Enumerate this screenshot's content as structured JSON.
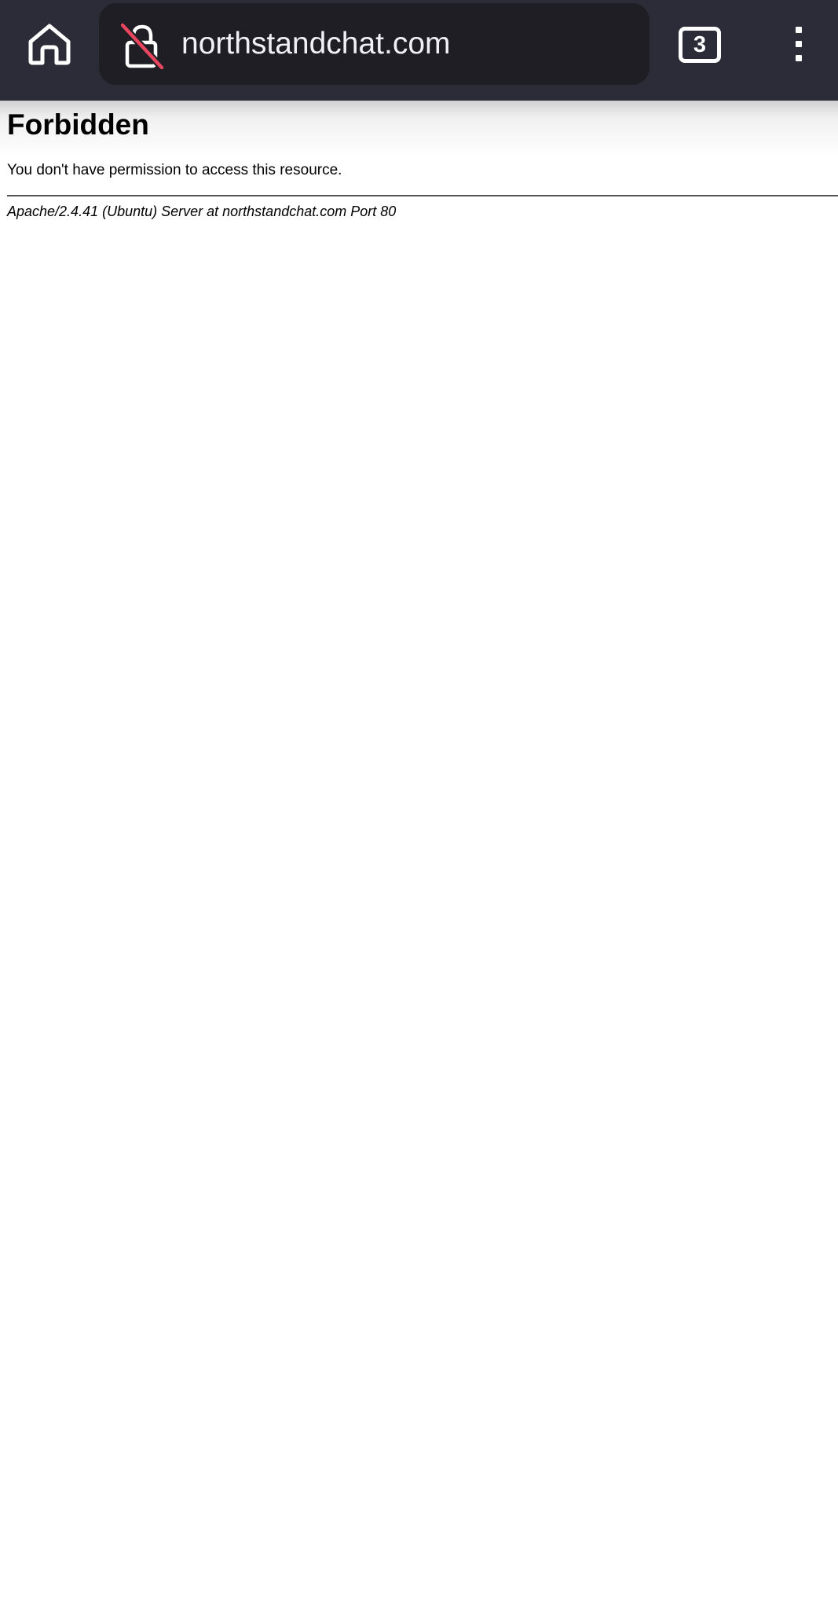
{
  "browser": {
    "url": "northstandchat.com",
    "tab_count": "3",
    "icons": {
      "home": "home-icon",
      "lock": "not-secure-lock-icon",
      "tabs": "tabs-icon",
      "menu": "more-vert-icon"
    },
    "colors": {
      "toolbar_bg": "#2c2c38",
      "urlbar_bg": "#1e1e24",
      "insecure_slash": "#e8455f"
    }
  },
  "page": {
    "title": "Forbidden",
    "message": "You don't have permission to access this resource.",
    "server_signature": "Apache/2.4.41 (Ubuntu) Server at northstandchat.com Port 80"
  }
}
